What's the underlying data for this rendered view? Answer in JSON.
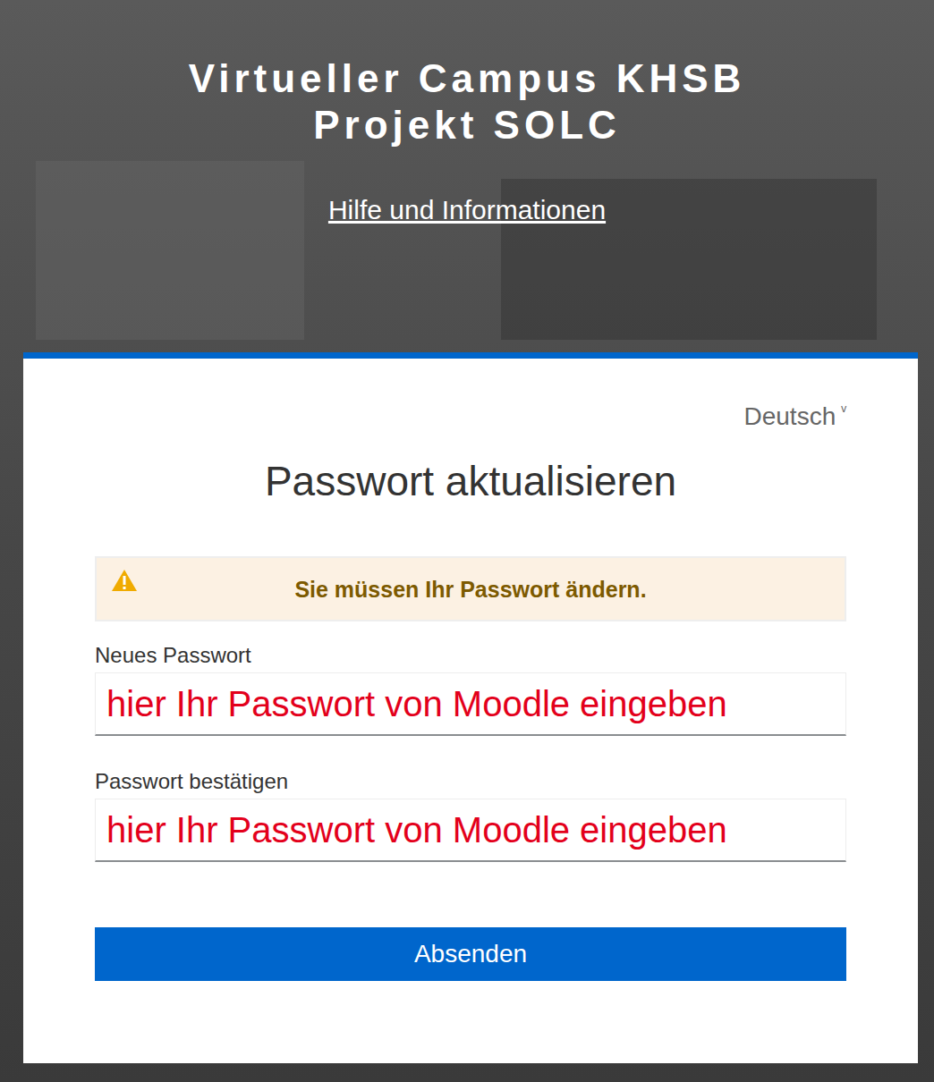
{
  "header": {
    "title_line1": "Virtueller Campus KHSB",
    "title_line2": "Projekt SOLC",
    "help_link": "Hilfe und Informationen"
  },
  "card": {
    "language": "Deutsch",
    "language_caret": "ᵛ",
    "heading": "Passwort aktualisieren",
    "warning": "Sie müssen Ihr Passwort ändern.",
    "fields": [
      {
        "label": "Neues Passwort",
        "value": "hier Ihr Passwort von Moodle eingeben"
      },
      {
        "label": "Passwort bestätigen",
        "value": "hier Ihr Passwort von Moodle eingeben"
      }
    ],
    "button": "Absenden"
  }
}
